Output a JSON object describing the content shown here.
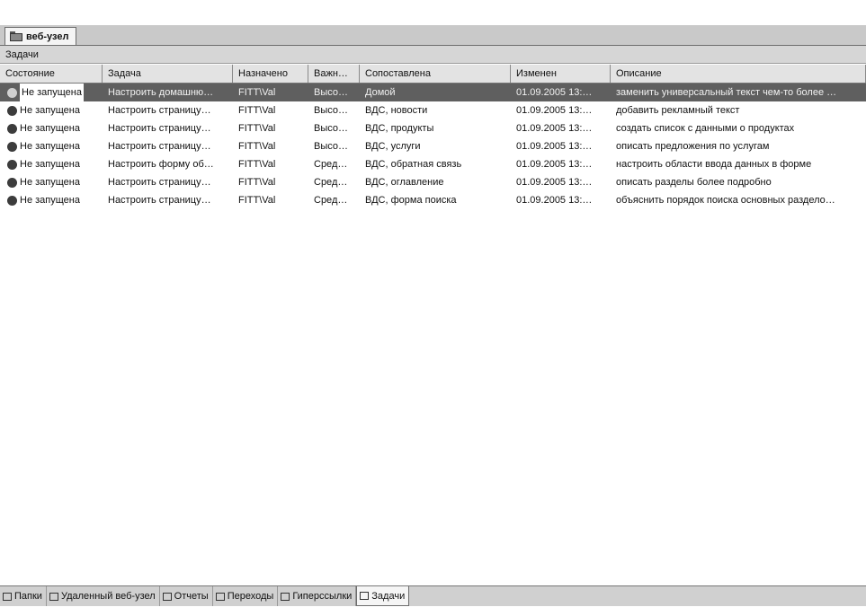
{
  "document_tab": {
    "label": "веб-узел",
    "icon": "website-folder-icon"
  },
  "pane": {
    "title": "Задачи"
  },
  "columns": [
    "Состояние",
    "Задача",
    "Назначено",
    "Важн…",
    "Сопоставлена",
    "Изменен",
    "Описание"
  ],
  "rows": [
    {
      "status": "Не запущена",
      "task": "Настроить домашню…",
      "assigned": "FITT\\Val",
      "priority": "Высо…",
      "linked": "Домой",
      "modified": "01.09.2005 13:…",
      "description": "заменить универсальный текст чем-то более …",
      "selected": true
    },
    {
      "status": "Не запущена",
      "task": "Настроить страницу…",
      "assigned": "FITT\\Val",
      "priority": "Высо…",
      "linked": "ВДС, новости",
      "modified": "01.09.2005 13:…",
      "description": "добавить рекламный текст"
    },
    {
      "status": "Не запущена",
      "task": "Настроить страницу…",
      "assigned": "FITT\\Val",
      "priority": "Высо…",
      "linked": "ВДС, продукты",
      "modified": "01.09.2005 13:…",
      "description": "создать список с данными о продуктах"
    },
    {
      "status": "Не запущена",
      "task": "Настроить страницу…",
      "assigned": "FITT\\Val",
      "priority": "Высо…",
      "linked": "ВДС, услуги",
      "modified": "01.09.2005 13:…",
      "description": "описать предложения по услугам"
    },
    {
      "status": "Не запущена",
      "task": "Настроить форму об…",
      "assigned": "FITT\\Val",
      "priority": "Сред…",
      "linked": "ВДС, обратная связь",
      "modified": "01.09.2005 13:…",
      "description": "настроить области ввода данных в форме"
    },
    {
      "status": "Не запущена",
      "task": "Настроить страницу…",
      "assigned": "FITT\\Val",
      "priority": "Сред…",
      "linked": "ВДС, оглавление",
      "modified": "01.09.2005 13:…",
      "description": "описать разделы более подробно"
    },
    {
      "status": "Не запущена",
      "task": "Настроить страницу…",
      "assigned": "FITT\\Val",
      "priority": "Сред…",
      "linked": "ВДС, форма поиска",
      "modified": "01.09.2005 13:…",
      "description": "объяснить порядок поиска основных раздело…"
    }
  ],
  "view_tabs": [
    {
      "label": "Папки",
      "icon": "folder-icon"
    },
    {
      "label": "Удаленный веб-узел",
      "icon": "remote-site-icon"
    },
    {
      "label": "Отчеты",
      "icon": "reports-icon"
    },
    {
      "label": "Переходы",
      "icon": "navigation-icon"
    },
    {
      "label": "Гиперссылки",
      "icon": "hyperlinks-icon"
    },
    {
      "label": "Задачи",
      "icon": "tasks-icon",
      "active": true
    }
  ]
}
